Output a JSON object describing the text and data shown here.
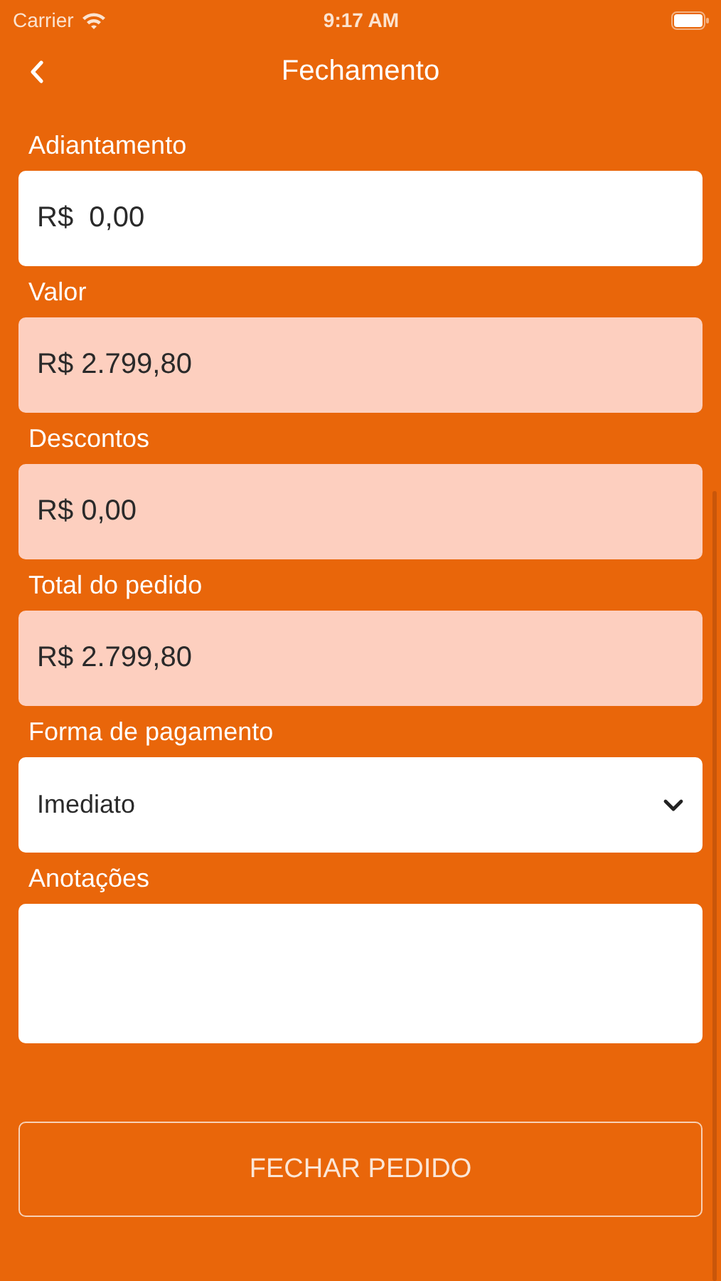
{
  "status_bar": {
    "carrier": "Carrier",
    "time": "9:17 AM"
  },
  "nav": {
    "title": "Fechamento"
  },
  "fields": [
    {
      "kind": "input",
      "label": "Adiantamento",
      "value": "R$  0,00",
      "disabled": false
    },
    {
      "kind": "input",
      "label": "Valor",
      "value": "R$ 2.799,80",
      "disabled": true
    },
    {
      "kind": "input",
      "label": "Descontos",
      "value": "R$ 0,00",
      "disabled": true
    },
    {
      "kind": "input",
      "label": "Total do pedido",
      "value": "R$ 2.799,80",
      "disabled": true
    },
    {
      "kind": "select",
      "label": "Forma de pagamento",
      "value": "Imediato",
      "disabled": false
    },
    {
      "kind": "textarea",
      "label": "Anotações",
      "disabled": false
    }
  ],
  "submit_button": {
    "label": "FECHAR PEDIDO"
  }
}
